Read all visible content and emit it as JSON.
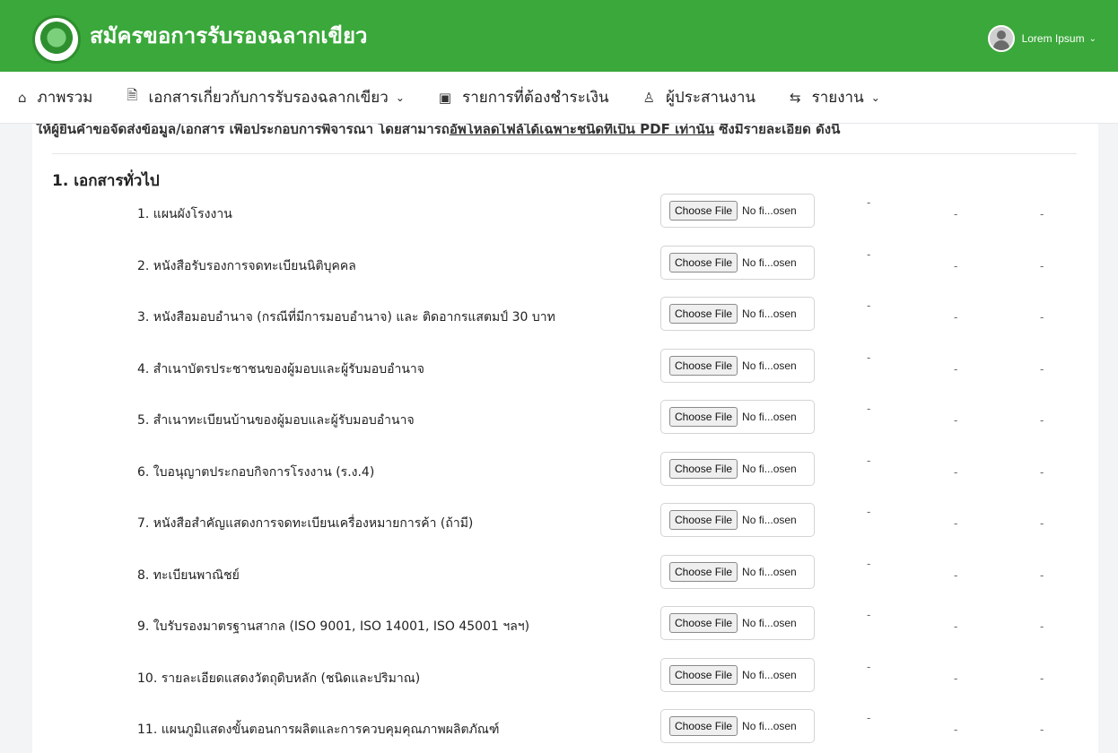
{
  "app": {
    "title": "สมัครขอการรับรองฉลากเขียว",
    "user_name": "Lorem Ipsum",
    "user_caret": "⌄"
  },
  "nav": [
    {
      "icon": "⌂",
      "label": "ภาพรวม",
      "dropdown": ""
    },
    {
      "icon": "🗎",
      "label": "เอกสารเกี่ยวกับการรับรองฉลากเขียว",
      "dropdown": "⌄"
    },
    {
      "icon": "▣",
      "label": "รายการที่ต้องชำระเงิน",
      "dropdown": ""
    },
    {
      "icon": "♙",
      "label": "ผู้ประสานงาน",
      "dropdown": ""
    },
    {
      "icon": "⇆",
      "label": "รายงาน",
      "dropdown": "⌄"
    }
  ],
  "intro": {
    "prefix": "ให้ผู้ยื่นคำขอจัดส่งข้อมูล/เอกสาร เพื่อประกอบการพิจารณา โดยสามารถ",
    "underlined": "อัพโหลดไฟล์ได้เฉพาะชนิดที่เป็น PDF เท่านั้น",
    "suffix": " ซึ่งมีรายละเอียด ดังนี้"
  },
  "section": {
    "title": "1. เอกสารทั่วไป"
  },
  "file_input": {
    "button": "Choose File",
    "status": "No fi...osen"
  },
  "placeholder_dash": "-",
  "documents": [
    {
      "label": "1. แผนผังโรงงาน"
    },
    {
      "label": "2. หนังสือรับรองการจดทะเบียนนิติบุคคล"
    },
    {
      "label": "3. หนังสือมอบอำนาจ (กรณีที่มีการมอบอำนาจ) และ ติดอากรแสตมป์ 30 บาท"
    },
    {
      "label": "4. สำเนาบัตรประชาชนของผู้มอบและผู้รับมอบอำนาจ"
    },
    {
      "label": "5. สำเนาทะเบียนบ้านของผู้มอบและผู้รับมอบอำนาจ"
    },
    {
      "label": "6. ใบอนุญาตประกอบกิจการโรงงาน (ร.ง.4)"
    },
    {
      "label": "7. หนังสือสำคัญแสดงการจดทะเบียนเครื่องหมายการค้า (ถ้ามี)"
    },
    {
      "label": "8. ทะเบียนพาณิชย์"
    },
    {
      "label": "9. ใบรับรองมาตรฐานสากล (ISO 9001, ISO 14001, ISO 45001 ฯลฯ)"
    },
    {
      "label": "10. รายละเอียดแสดงวัตถุดิบหลัก (ชนิดและปริมาณ)"
    },
    {
      "label": "11. แผนภูมิแสดงขั้นตอนการผลิตและการควบคุมคุณภาพผลิตภัณฑ์"
    }
  ]
}
